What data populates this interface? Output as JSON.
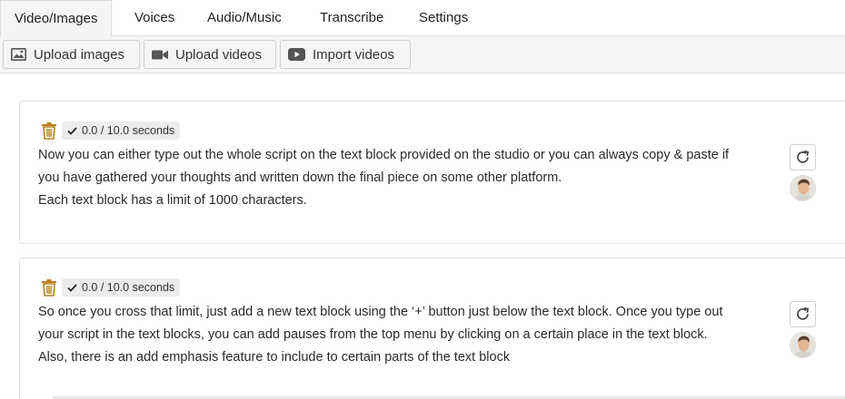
{
  "tabs": [
    {
      "label": "Video/Images",
      "active": true
    },
    {
      "label": "Voices",
      "active": false
    },
    {
      "label": "Audio/Music",
      "active": false
    },
    {
      "label": "Transcribe",
      "active": false
    },
    {
      "label": "Settings",
      "active": false
    }
  ],
  "toolbar": {
    "upload_images": "Upload images",
    "upload_videos": "Upload videos",
    "import_videos": "Import videos"
  },
  "blocks": [
    {
      "duration": "0.0 / 10.0 seconds",
      "lines": [
        "Now you can either type out the whole script on the text block provided on the studio or you can always copy & paste if",
        "you have gathered your thoughts and written down the final piece on some other platform.",
        "Each text block has a limit of 1000 characters."
      ]
    },
    {
      "duration": "0.0 / 10.0 seconds",
      "lines": [
        "So once you cross that limit, just add a new text block using the ‘+’ button just below the text block. Once you type out",
        "your script in the text blocks, you can add pauses from the top menu by clicking on a certain place in the text block.",
        "Also, there is an add emphasis feature to include to certain parts of the text block"
      ]
    }
  ],
  "colors": {
    "trash": "#b8801f",
    "tab_active_bg": "#f4f5f6",
    "border": "#dcdcdc"
  },
  "icons": {
    "trash": "trash-icon",
    "check": "check-icon",
    "refresh": "refresh-icon",
    "image": "image-icon",
    "video": "video-camera-icon",
    "youtube": "play-icon"
  }
}
